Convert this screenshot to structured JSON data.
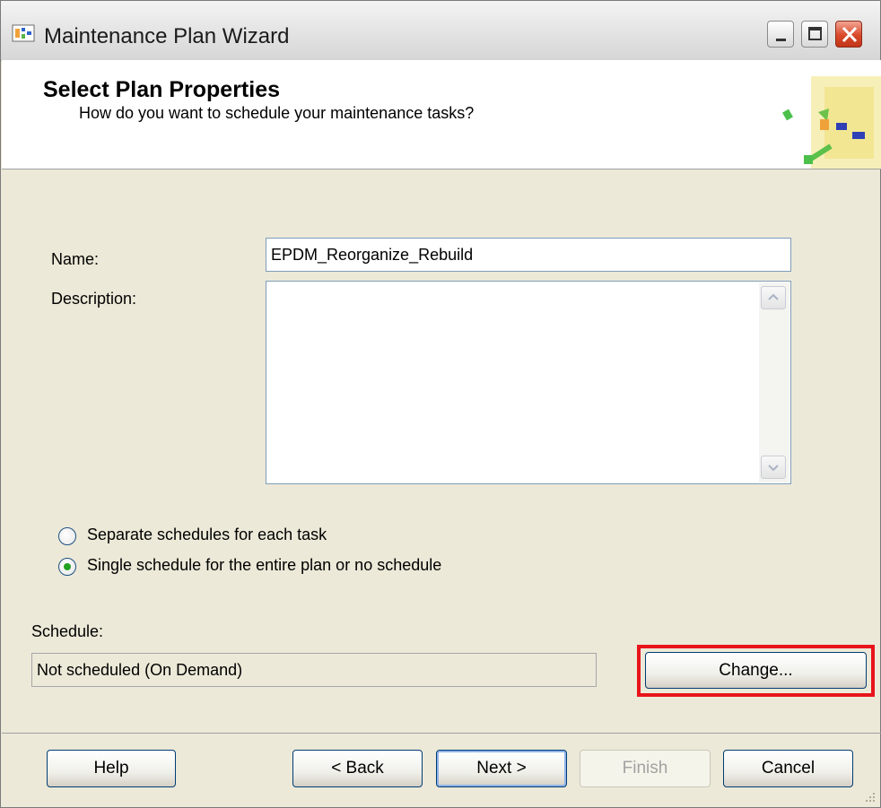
{
  "window": {
    "title": "Maintenance Plan Wizard"
  },
  "header": {
    "title": "Select Plan Properties",
    "subtitle": "How do you want to schedule your maintenance tasks?"
  },
  "form": {
    "name_label": "Name:",
    "name_value": "EPDM_Reorganize_Rebuild",
    "description_label": "Description:",
    "description_value": ""
  },
  "schedule_options": {
    "separate_label": "Separate schedules for each task",
    "single_label": "Single schedule for the entire plan or no schedule",
    "selected": "single"
  },
  "schedule": {
    "label": "Schedule:",
    "value": "Not scheduled (On Demand)",
    "change_label": "Change..."
  },
  "footer": {
    "help_label": "Help",
    "back_label": "< Back",
    "next_label": "Next >",
    "finish_label": "Finish",
    "cancel_label": "Cancel"
  },
  "colors": {
    "highlight": "#e8141b",
    "radio_dot": "#21a121",
    "background": "#ece9d8"
  }
}
